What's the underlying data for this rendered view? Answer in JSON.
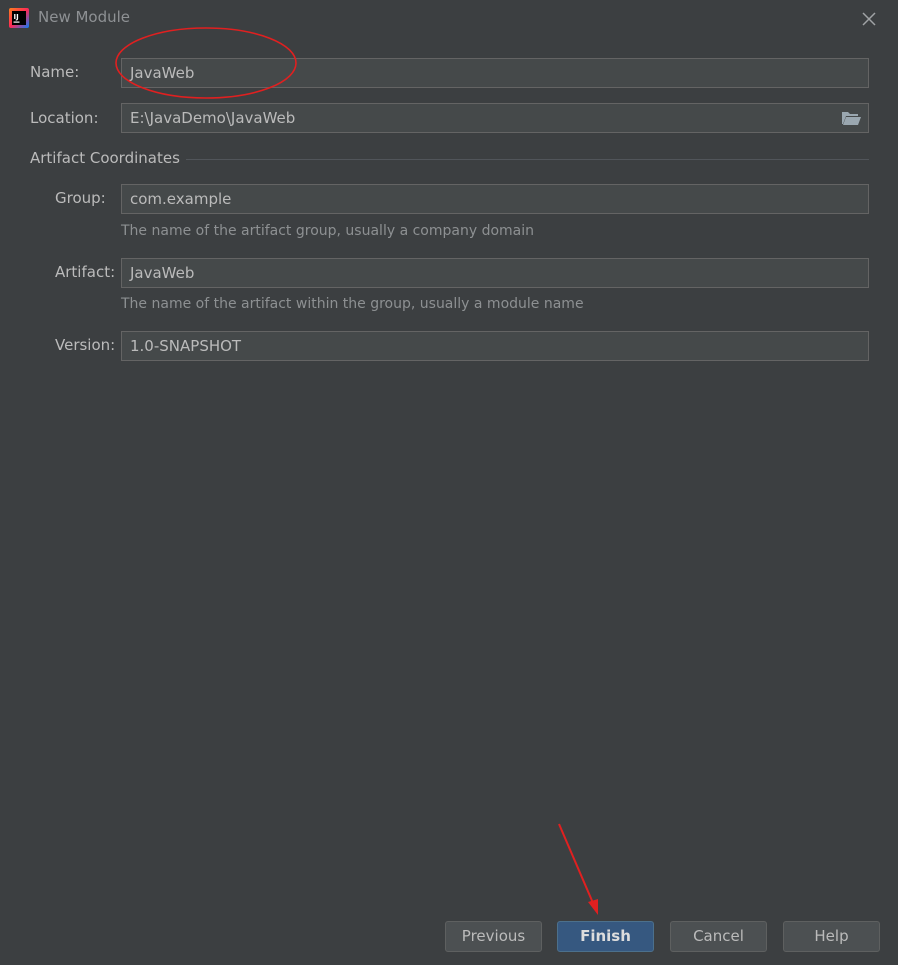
{
  "window": {
    "title": "New Module",
    "app_icon_text": "IJ"
  },
  "form": {
    "name": {
      "label": "Name:",
      "value": "JavaWeb"
    },
    "location": {
      "label": "Location:",
      "value": "E:\\JavaDemo\\JavaWeb"
    },
    "section_title": "Artifact Coordinates",
    "group": {
      "label": "Group:",
      "value": "com.example",
      "hint": "The name of the artifact group, usually a company domain"
    },
    "artifact": {
      "label": "Artifact:",
      "value": "JavaWeb",
      "hint": "The name of the artifact within the group, usually a module name"
    },
    "version": {
      "label": "Version:",
      "value": "1.0-SNAPSHOT"
    }
  },
  "buttons": {
    "previous": "Previous",
    "finish": "Finish",
    "cancel": "Cancel",
    "help": "Help"
  },
  "colors": {
    "background": "#3c3f41",
    "field_background": "#45494a",
    "primary_button": "#365880",
    "annotation_red": "#e02020"
  },
  "icons": {
    "app": "intellij-idea-icon",
    "close": "close-icon",
    "folder": "folder-open-icon"
  }
}
